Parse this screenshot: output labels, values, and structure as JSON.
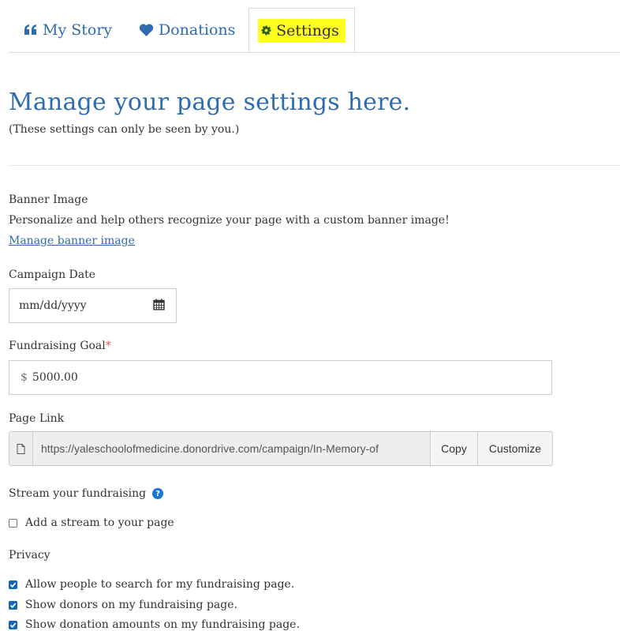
{
  "tabs": {
    "my_story": "My Story",
    "donations": "Donations",
    "settings": "Settings"
  },
  "header": {
    "title": "Manage your page settings here.",
    "subtitle": "(These settings can only be seen by you.)"
  },
  "banner": {
    "label": "Banner Image",
    "description": "Personalize and help others recognize your page with a custom banner image!",
    "link": "Manage banner image"
  },
  "campaign_date": {
    "label": "Campaign Date",
    "placeholder": "mm/dd/yyyy"
  },
  "goal": {
    "label": "Fundraising Goal",
    "required_mark": "*",
    "currency": "$",
    "value": "5000.00"
  },
  "page_link": {
    "label": "Page Link",
    "url": "https://yaleschoolofmedicine.donordrive.com/campaign/In-Memory-of",
    "copy_label": "Copy",
    "customize_label": "Customize"
  },
  "stream": {
    "label": "Stream your fundraising",
    "checkbox_label": "Add a stream to your page",
    "checked": false
  },
  "privacy": {
    "label": "Privacy",
    "options": [
      {
        "label": "Allow people to search for my fundraising page.",
        "checked": true
      },
      {
        "label": "Show donors on my fundraising page.",
        "checked": true
      },
      {
        "label": "Show donation amounts on my fundraising page.",
        "checked": true
      }
    ]
  },
  "colors": {
    "accent": "#2f6bb0",
    "highlight": "#ffff1f",
    "checkbox": "#1565c0"
  }
}
